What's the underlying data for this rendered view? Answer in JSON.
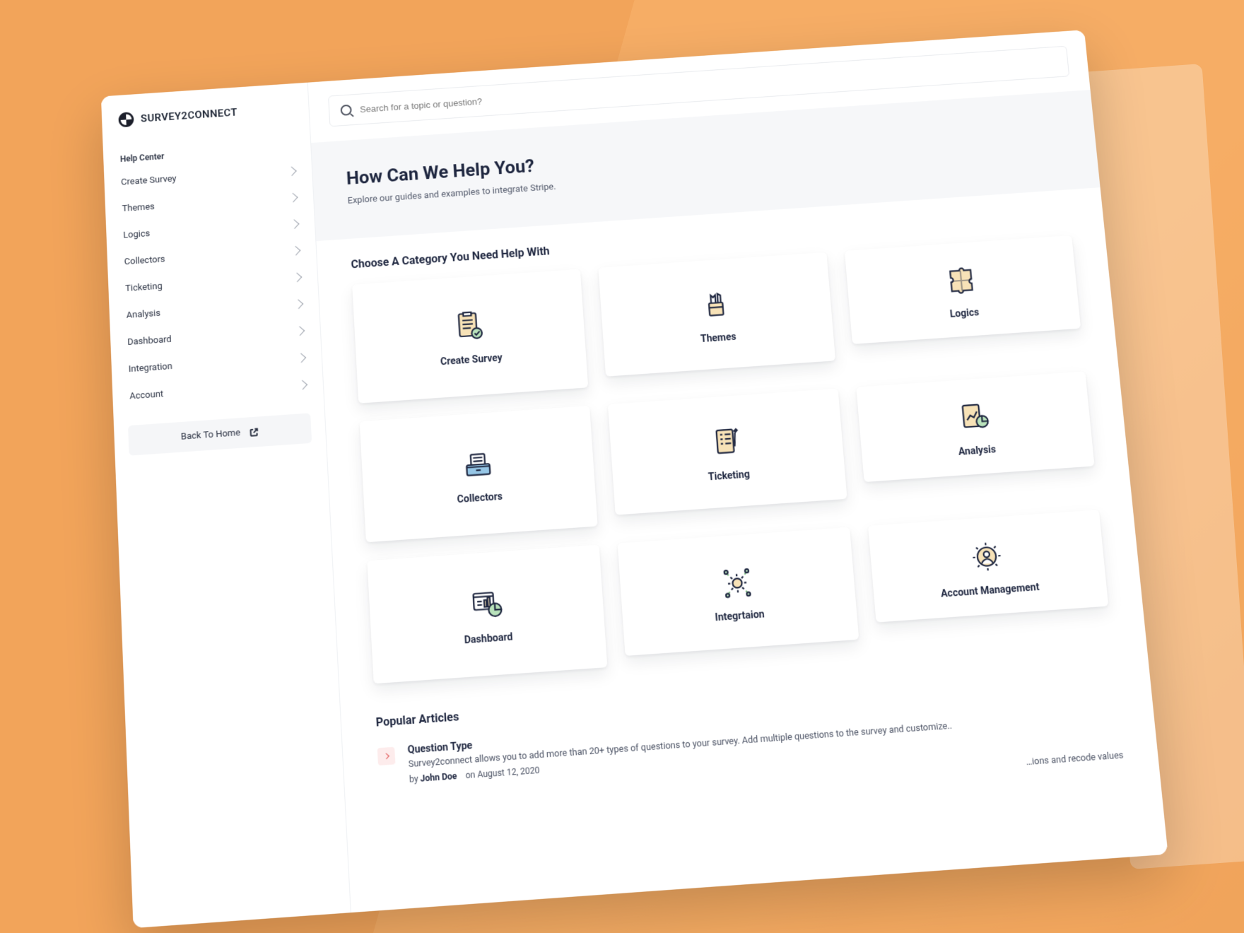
{
  "brand": {
    "name": "SURVEY2CONNECT"
  },
  "sidebar": {
    "section_label": "Help Center",
    "items": [
      {
        "label": "Create Survey"
      },
      {
        "label": "Themes"
      },
      {
        "label": "Logics"
      },
      {
        "label": "Collectors"
      },
      {
        "label": "Ticketing"
      },
      {
        "label": "Analysis"
      },
      {
        "label": "Dashboard"
      },
      {
        "label": "Integration"
      },
      {
        "label": "Account"
      }
    ],
    "back_home_label": "Back To Home"
  },
  "search": {
    "placeholder": "Search for a topic or question?"
  },
  "hero": {
    "title": "How Can We Help You?",
    "subtitle": "Explore our guides and examples to integrate Stripe."
  },
  "categories": {
    "heading": "Choose A Category You Need Help With",
    "items": [
      {
        "label": "Create Survey",
        "icon": "clipboard-check-icon"
      },
      {
        "label": "Themes",
        "icon": "pencil-cup-icon"
      },
      {
        "label": "Logics",
        "icon": "puzzle-icon"
      },
      {
        "label": "Collectors",
        "icon": "drawer-icon"
      },
      {
        "label": "Ticketing",
        "icon": "ticket-list-icon"
      },
      {
        "label": "Analysis",
        "icon": "chart-page-icon"
      },
      {
        "label": "Dashboard",
        "icon": "dashboard-pie-icon"
      },
      {
        "label": "Integrtaion",
        "icon": "gears-sync-icon"
      },
      {
        "label": "Account Management",
        "icon": "user-gear-icon"
      }
    ]
  },
  "popular": {
    "heading": "Popular Articles",
    "articles": [
      {
        "title": "Question Type",
        "desc": "Survey2connect allows you to add more than 20+ types of questions to your survey. Add multiple questions to the survey and customize..",
        "by_label": "by",
        "author": "John Doe",
        "on_label": "on",
        "date": "August 12, 2020"
      },
      {
        "trailing_desc": "…ions and recode values"
      }
    ]
  },
  "colors": {
    "ink": "#1f2740",
    "muted": "#52596b",
    "accent_orange": "#f4a24d",
    "accent_blue": "#96c6e6",
    "accent_cream": "#f7e2b7",
    "accent_green": "#b9e2bb"
  }
}
